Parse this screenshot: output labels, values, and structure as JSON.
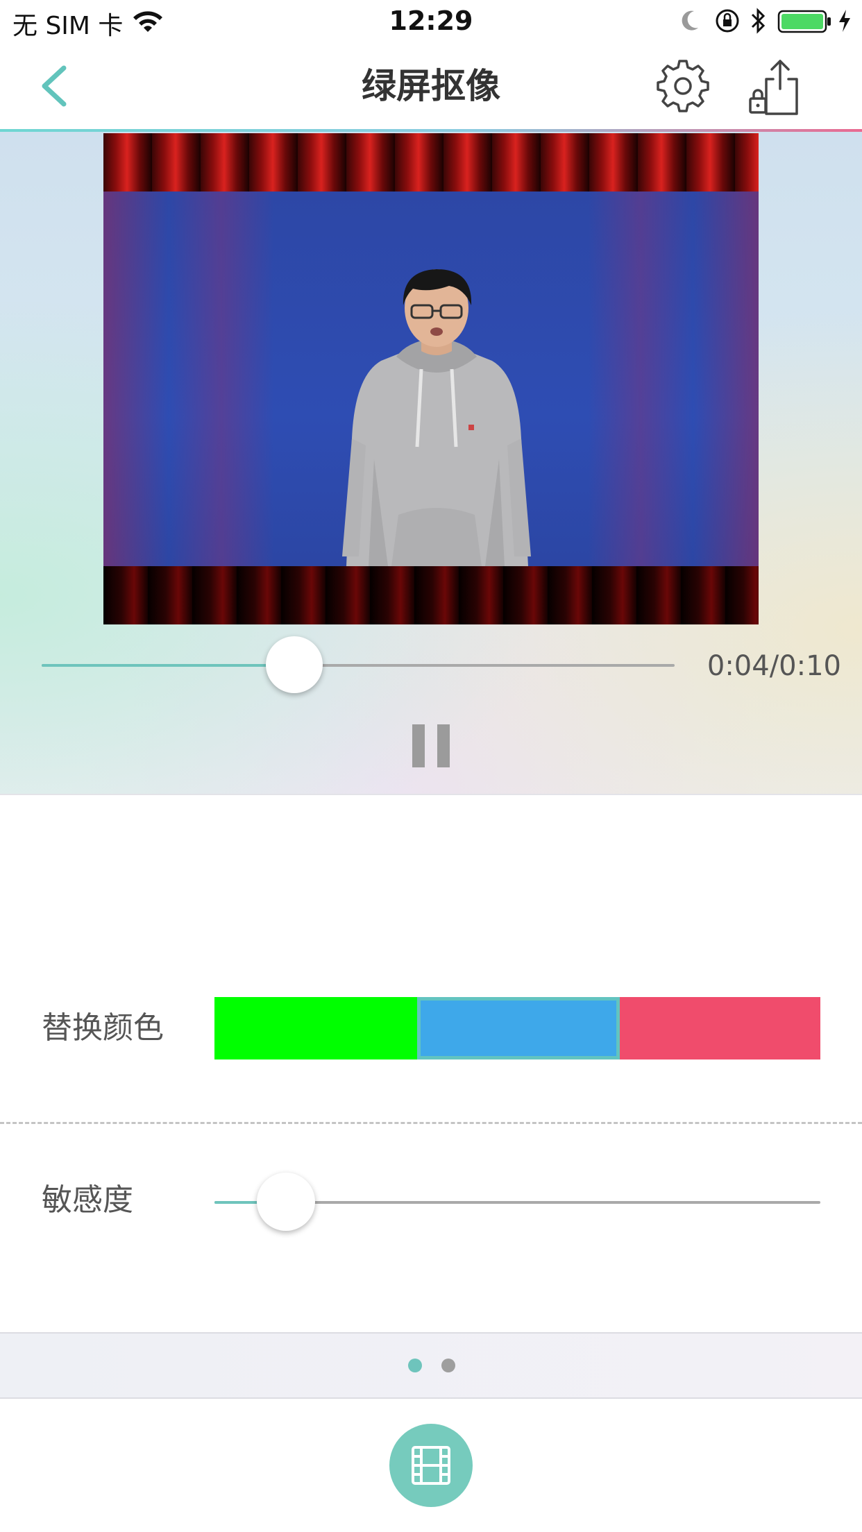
{
  "status_bar": {
    "carrier": "无 SIM 卡",
    "time": "12:29",
    "battery_color": "#4cd964"
  },
  "nav": {
    "title": "绿屏抠像",
    "back_icon": "chevron-left-icon",
    "settings_icon": "gear-icon",
    "share_icon": "share-locked-icon",
    "accent_color": "#6ec4bc"
  },
  "player": {
    "current_time": "0:04",
    "duration": "0:10",
    "time_display": "0:04/0:10",
    "progress_fraction": 0.4,
    "state": "playing",
    "pause_icon": "pause-icon"
  },
  "replace_color": {
    "label": "替换颜色",
    "options": [
      {
        "color": "#00ff00",
        "selected": false
      },
      {
        "color": "#3ea8ea",
        "selected": true
      },
      {
        "color": "#f04c6c",
        "selected": false
      }
    ]
  },
  "sensitivity": {
    "label": "敏感度",
    "value_fraction": 0.1
  },
  "pager": {
    "page_count": 2,
    "current_page": 1
  },
  "bottom_button": {
    "icon": "film-icon"
  }
}
